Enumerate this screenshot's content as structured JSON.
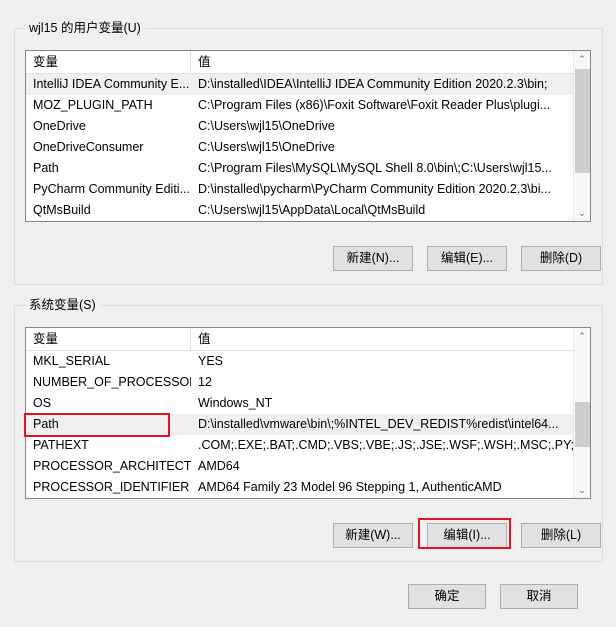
{
  "dialog": {
    "background_color": "#f0f0f0",
    "annotation_color": "#e81123"
  },
  "user_section": {
    "title": "wjl15 的用户变量(U)",
    "columns": [
      "变量",
      "值"
    ],
    "rows": [
      {
        "name": "IntelliJ IDEA Community E...",
        "value": "D:\\installed\\IDEA\\IntelliJ IDEA Community Edition 2020.2.3\\bin;",
        "selected": true
      },
      {
        "name": "MOZ_PLUGIN_PATH",
        "value": "C:\\Program Files (x86)\\Foxit Software\\Foxit Reader Plus\\plugi...",
        "selected": false
      },
      {
        "name": "OneDrive",
        "value": "C:\\Users\\wjl15\\OneDrive",
        "selected": false
      },
      {
        "name": "OneDriveConsumer",
        "value": "C:\\Users\\wjl15\\OneDrive",
        "selected": false
      },
      {
        "name": "Path",
        "value": "C:\\Program Files\\MySQL\\MySQL Shell 8.0\\bin\\;C:\\Users\\wjl15...",
        "selected": false
      },
      {
        "name": "PyCharm Community Editi...",
        "value": "D:\\installed\\pycharm\\PyCharm Community Edition 2020.2.3\\bi...",
        "selected": false
      },
      {
        "name": "QtMsBuild",
        "value": "C:\\Users\\wjl15\\AppData\\Local\\QtMsBuild",
        "selected": false
      }
    ],
    "buttons": {
      "new": "新建(N)...",
      "edit": "编辑(E)...",
      "delete": "删除(D)"
    },
    "scrollbar": {
      "up_arrow": "⌃",
      "down_arrow": "⌄"
    }
  },
  "system_section": {
    "title": "系统变量(S)",
    "columns": [
      "变量",
      "值"
    ],
    "rows": [
      {
        "name": "MKL_SERIAL",
        "value": "YES",
        "selected": false
      },
      {
        "name": "NUMBER_OF_PROCESSORS",
        "value": "12",
        "selected": false
      },
      {
        "name": "OS",
        "value": "Windows_NT",
        "selected": false
      },
      {
        "name": "Path",
        "value": "D:\\installed\\vmware\\bin\\;%INTEL_DEV_REDIST%redist\\intel64...",
        "selected": true
      },
      {
        "name": "PATHEXT",
        "value": ".COM;.EXE;.BAT;.CMD;.VBS;.VBE;.JS;.JSE;.WSF;.WSH;.MSC;.PY;.P...",
        "selected": false
      },
      {
        "name": "PROCESSOR_ARCHITECT...",
        "value": "AMD64",
        "selected": false
      },
      {
        "name": "PROCESSOR_IDENTIFIER",
        "value": "AMD64 Family 23 Model 96 Stepping 1, AuthenticAMD",
        "selected": false
      }
    ],
    "buttons": {
      "new": "新建(W)...",
      "edit": "编辑(I)...",
      "delete": "删除(L)"
    },
    "scrollbar": {
      "up_arrow": "⌃",
      "down_arrow": "⌄"
    }
  },
  "footer": {
    "ok": "确定",
    "cancel": "取消"
  }
}
